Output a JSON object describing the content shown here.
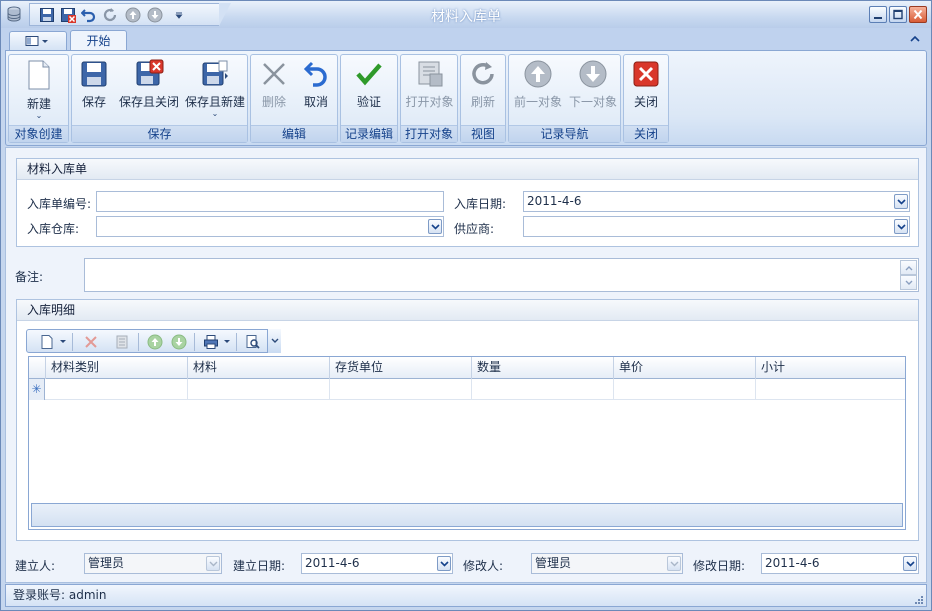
{
  "window": {
    "title": "材料入库单"
  },
  "tabs": {
    "start": "开始"
  },
  "ribbon": {
    "groups": [
      {
        "label": "对象创建"
      },
      {
        "label": "保存"
      },
      {
        "label": "编辑"
      },
      {
        "label": "记录编辑"
      },
      {
        "label": "打开对象"
      },
      {
        "label": "视图"
      },
      {
        "label": "记录导航"
      },
      {
        "label": "关闭"
      }
    ],
    "buttons": {
      "new": "新建",
      "save": "保存",
      "save_close": "保存且关闭",
      "save_new": "保存且新建",
      "delete": "删除",
      "cancel": "取消",
      "validate": "验证",
      "open_object": "打开对象",
      "refresh": "刷新",
      "prev": "前一对象",
      "next": "下一对象",
      "close": "关闭"
    }
  },
  "form": {
    "section_title": "材料入库单",
    "code_label": "入库单编号:",
    "code_value": "",
    "date_label": "入库日期:",
    "date_value": "2011-4-6",
    "warehouse_label": "入库仓库:",
    "warehouse_value": "",
    "supplier_label": "供应商:",
    "supplier_value": "",
    "remark_label": "备注:",
    "remark_value": ""
  },
  "detail": {
    "section_title": "入库明细",
    "columns": [
      "材料类别",
      "材料",
      "存货单位",
      "数量",
      "单价",
      "小计"
    ]
  },
  "footer": {
    "creator_label": "建立人:",
    "creator_value": "管理员",
    "created_label": "建立日期:",
    "created_value": "2011-4-6",
    "modifier_label": "修改人:",
    "modifier_value": "管理员",
    "modified_label": "修改日期:",
    "modified_value": "2011-4-6"
  },
  "status": {
    "login": "登录账号: admin"
  },
  "colors": {
    "accent": "#15428b",
    "title_text": "#ffffff",
    "close_red": "#d9372b",
    "check_green": "#2f9a2a"
  }
}
